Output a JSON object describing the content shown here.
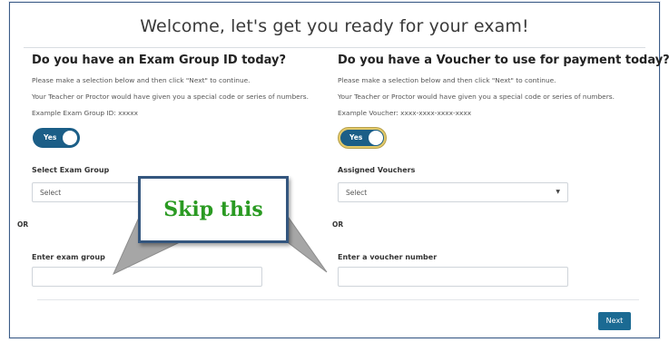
{
  "page": {
    "title": "Welcome, let's get you ready for your exam!"
  },
  "left": {
    "heading": "Do you have an Exam Group ID today?",
    "hint1": "Please make a selection below and then click \"Next\" to continue.",
    "hint2": "Your Teacher or Proctor would have given you a special code or series of numbers.",
    "hint3": "Example Exam Group ID: xxxxx",
    "toggle_label": "Yes",
    "select_label": "Select Exam Group",
    "select_value": "Select",
    "or_label": "OR",
    "input_label": "Enter exam group",
    "input_value": ""
  },
  "right": {
    "heading": "Do you have a Voucher to use for payment today?",
    "hint1": "Please make a selection below and then click \"Next\" to continue.",
    "hint2": "Your Teacher or Proctor would have given you a special code or series of numbers.",
    "hint3": "Example Voucher: xxxx-xxxx-xxxx-xxxx",
    "toggle_label": "Yes",
    "select_label": "Assigned Vouchers",
    "select_value": "Select",
    "or_label": "OR",
    "input_label": "Enter a voucher number",
    "input_value": ""
  },
  "footer": {
    "next_label": "Next"
  },
  "annotation": {
    "callout_text": "Skip this"
  },
  "colors": {
    "accent": "#1b5e87",
    "callout_border": "#34567e",
    "callout_text": "#2a9a22"
  },
  "icons": {
    "select_caret": "caret-down-icon"
  }
}
